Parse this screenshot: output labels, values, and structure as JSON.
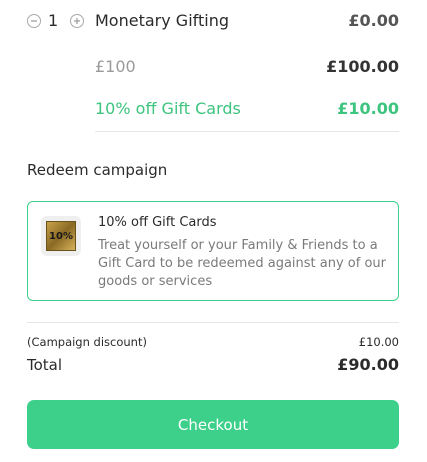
{
  "line_item": {
    "quantity": "1",
    "name": "Monetary Gifting",
    "price": "£0.00",
    "option_label": "£100",
    "option_price": "£100.00",
    "discount_label": "10% off Gift Cards",
    "discount_amount": "£10.00"
  },
  "redeem": {
    "title": "Redeem campaign",
    "campaign": {
      "badge_text": "10%",
      "title": "10% off Gift Cards",
      "description": "Treat yourself or your Family & Friends to a Gift Card to be redeemed against any of our goods or services"
    }
  },
  "summary": {
    "discount_label": "(Campaign discount)",
    "discount_amount": "£10.00",
    "total_label": "Total",
    "total_amount": "£90.00"
  },
  "checkout": {
    "label": "Checkout"
  },
  "colors": {
    "accent": "#3dd08a",
    "discount_text": "#3dc47e"
  },
  "icons": {
    "decrement": "minus-circle-icon",
    "increment": "plus-circle-icon"
  }
}
